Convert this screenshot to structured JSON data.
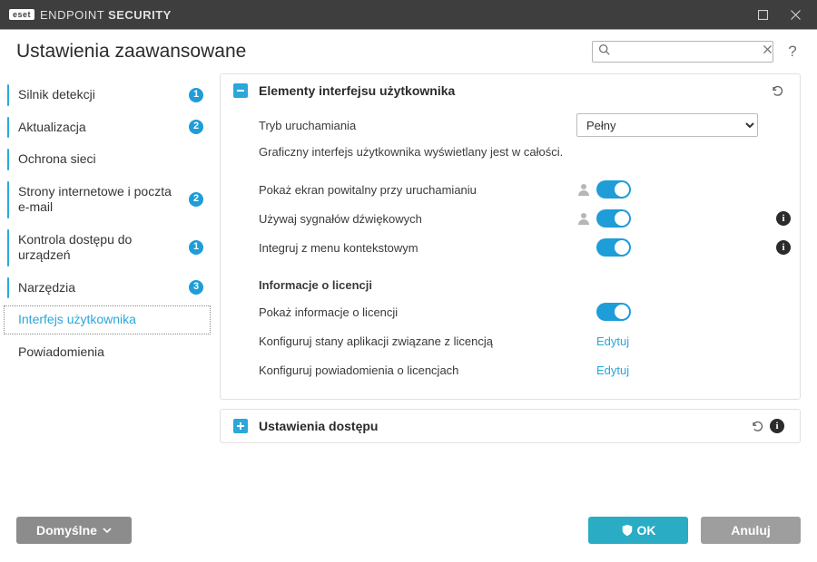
{
  "titlebar": {
    "brand_badge": "eset",
    "brand_light": "ENDPOINT ",
    "brand_bold": "SECURITY"
  },
  "header": {
    "title": "Ustawienia zaawansowane",
    "search_placeholder": "",
    "help": "?"
  },
  "sidebar": {
    "items": [
      {
        "label": "Silnik detekcji",
        "badge": "1",
        "bar": true
      },
      {
        "label": "Aktualizacja",
        "badge": "2",
        "bar": true
      },
      {
        "label": "Ochrona sieci",
        "badge": "",
        "bar": true
      },
      {
        "label": "Strony internetowe i poczta e-mail",
        "badge": "2",
        "bar": true
      },
      {
        "label": "Kontrola dostępu do urządzeń",
        "badge": "1",
        "bar": true
      },
      {
        "label": "Narzędzia",
        "badge": "3",
        "bar": true
      },
      {
        "label": "Interfejs użytkownika",
        "badge": "",
        "bar": false,
        "selected": true
      },
      {
        "label": "Powiadomienia",
        "badge": "",
        "bar": false
      }
    ]
  },
  "panel_ui": {
    "title": "Elementy interfejsu użytkownika",
    "mode_label": "Tryb uruchamiania",
    "mode_value": "Pełny",
    "mode_desc": "Graficzny interfejs użytkownika wyświetlany jest w całości.",
    "show_splash": "Pokaż ekran powitalny przy uruchamianiu",
    "use_sounds": "Używaj sygnałów dźwiękowych",
    "context_menu": "Integruj z menu kontekstowym",
    "license_hdr": "Informacje o licencji",
    "show_license": "Pokaż informacje o licencji",
    "conf_states": "Konfiguruj stany aplikacji związane z licencją",
    "conf_notifs": "Konfiguruj powiadomienia o licencjach",
    "edit": "Edytuj"
  },
  "panel_access": {
    "title": "Ustawienia dostępu"
  },
  "footer": {
    "default": "Domyślne",
    "ok": "OK",
    "cancel": "Anuluj"
  }
}
